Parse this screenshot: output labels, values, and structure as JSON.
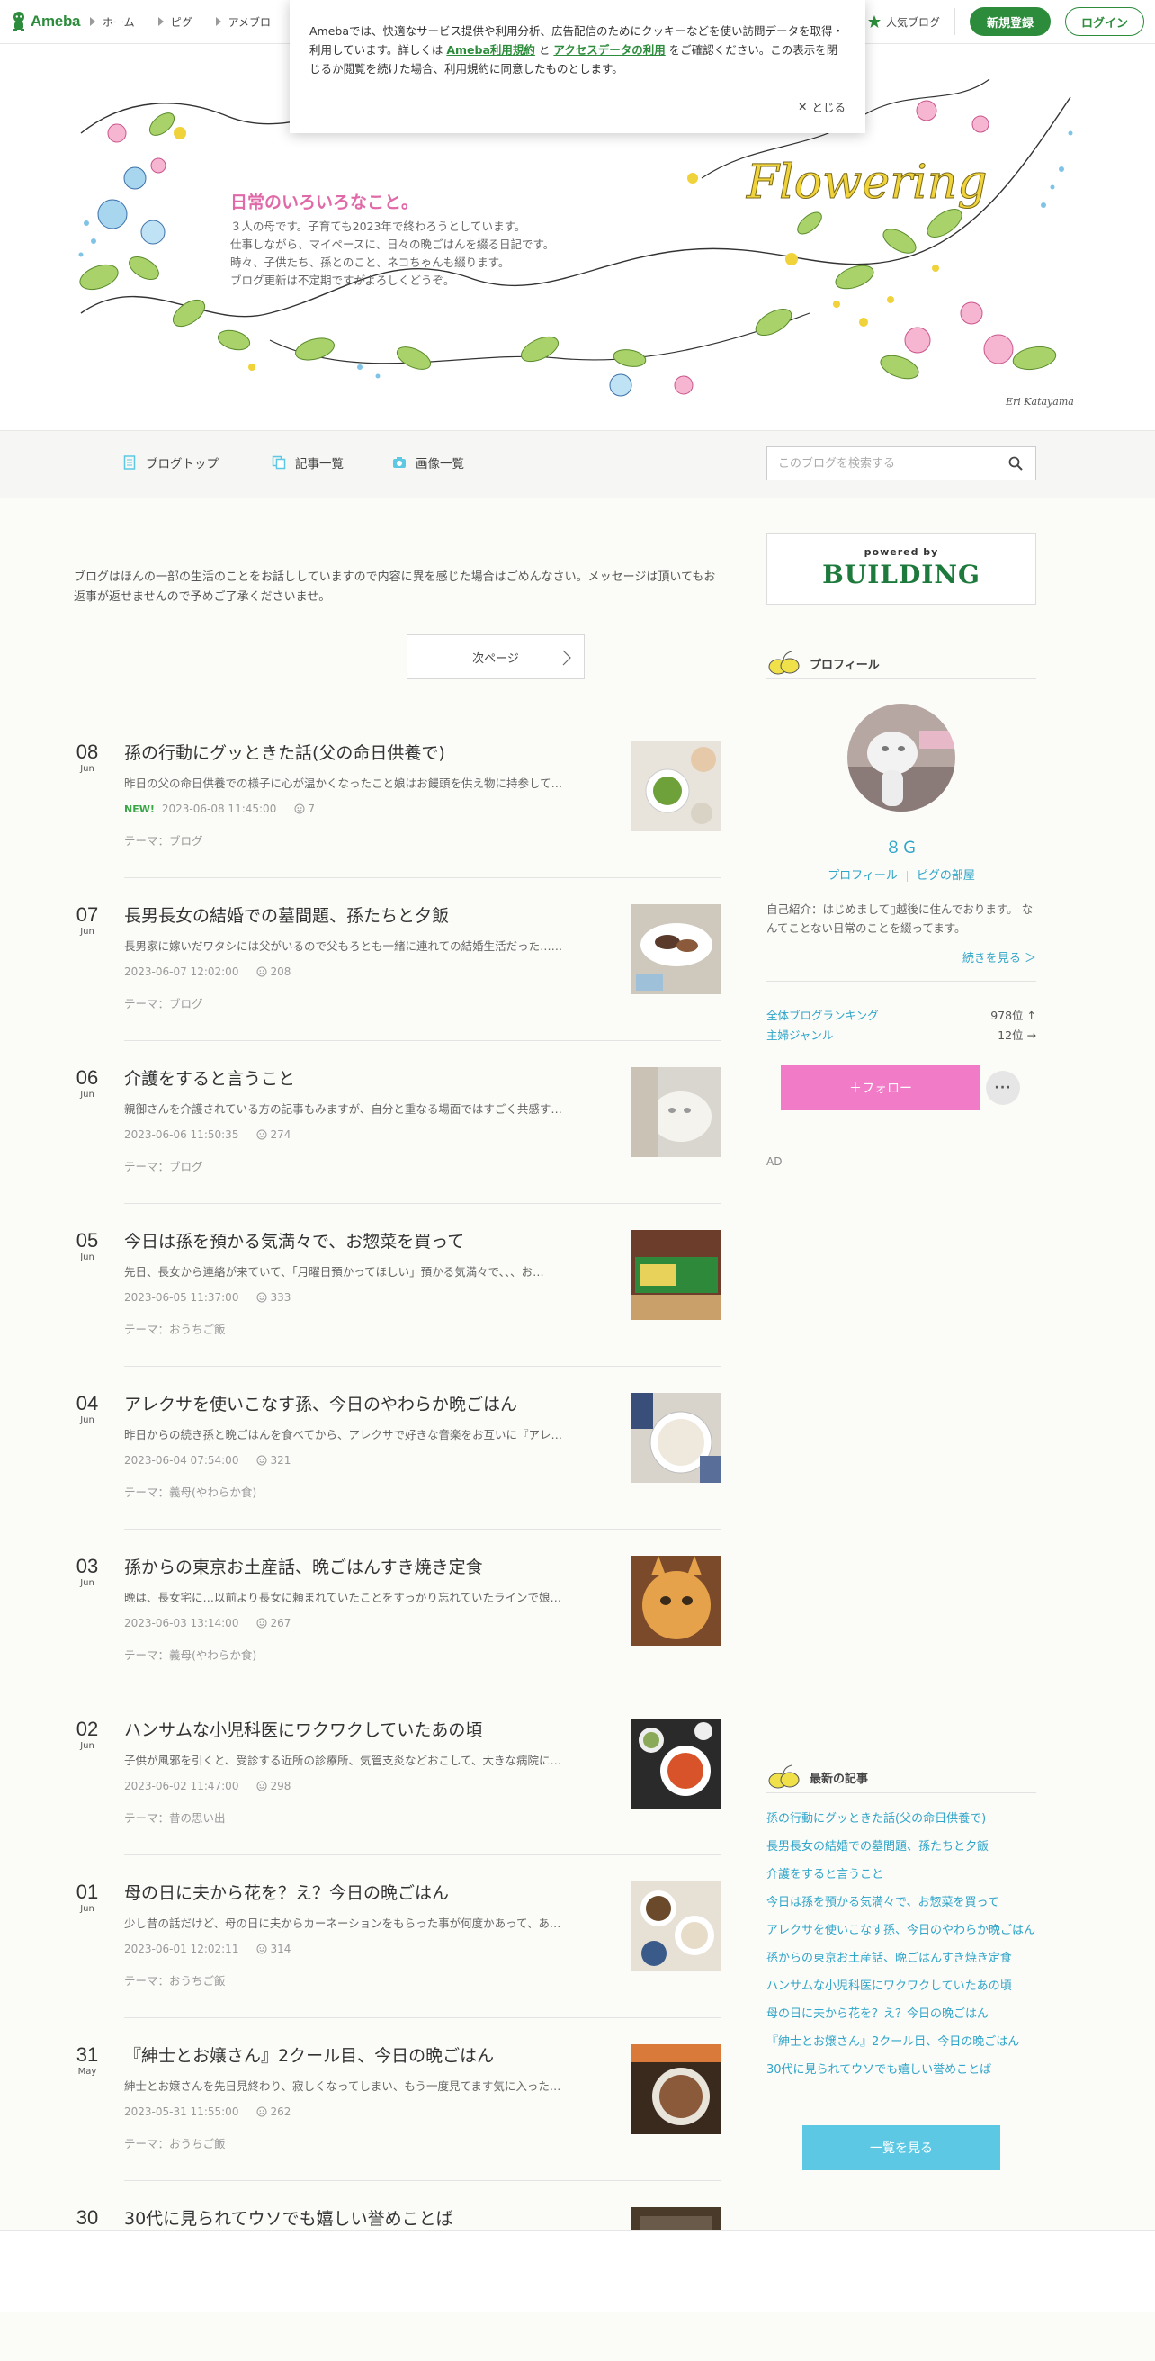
{
  "global_header": {
    "logo_text": "Ameba",
    "nav": [
      "ホーム",
      "ピグ",
      "アメブロ"
    ],
    "popular_blog": "人気ブログ",
    "register": "新規登録",
    "login": "ログイン"
  },
  "cookie_notice": {
    "text_before": "Amebaでは、快適なサービス提供や利用分析、広告配信のためにクッキーなどを使い訪問データを取得・利用しています。詳しくは ",
    "link_terms": "Ameba利用規約",
    "text_and": " と ",
    "link_access": "アクセスデータの利用",
    "text_after": " をご確認ください。この表示を閉じるか閲覧を続けた場合、利用規約に同意したものとします。",
    "close": "とじる"
  },
  "banner": {
    "title": "日常のいろいろなこと。",
    "description": "３人の母です。子育ても2023年で終わろうとしています。\n仕事しながら、マイペースに、日々の晩ごはんを綴る日記です。\n時々、子供たち、孫とのこと、ネコちゃんも綴ります。\nブログ更新は不定期ですがよろしくどうぞ。",
    "artwork_text": "Flowering",
    "signature": "Eri Katayama"
  },
  "blog_nav": {
    "items": [
      "ブログトップ",
      "記事一覧",
      "画像一覧"
    ],
    "search_placeholder": "このブログを検索する"
  },
  "notice": "ブログはほんの一部の生活のことをお話ししていますので内容に異を感じた場合はごめんなさい。メッセージは頂いてもお返事が返せませんので予めご了承くださいませ。",
  "next_page": "次ページ",
  "entries": [
    {
      "day": "08",
      "mon": "Jun",
      "title": "孫の行動にグッときた話(父の命日供養で)",
      "excerpt": "昨日の父の命日供養での様子に心が温かくなったこと娘はお饅頭を供え物に持参して…",
      "new": "NEW!",
      "datetime": "2023-06-08 11:45:00",
      "comments": "7",
      "theme": "テーマ：ブログ"
    },
    {
      "day": "07",
      "mon": "Jun",
      "title": "長男長女の結婚での墓間題、孫たちと夕飯",
      "excerpt": "長男家に嫁いだワタシには父がいるので父もろとも一緒に連れての結婚生活だった……",
      "new": "",
      "datetime": "2023-06-07 12:02:00",
      "comments": "208",
      "theme": "テーマ：ブログ"
    },
    {
      "day": "06",
      "mon": "Jun",
      "title": "介護をすると言うこと",
      "excerpt": "親御さんを介護されている方の記事もみますが、自分と重なる場面ではすごく共感す…",
      "new": "",
      "datetime": "2023-06-06 11:50:35",
      "comments": "274",
      "theme": "テーマ：ブログ"
    },
    {
      "day": "05",
      "mon": "Jun",
      "title": "今日は孫を預かる気満々で、お惣菜を買って",
      "excerpt": "先日、長女から連絡が来ていて、「月曜日預かってほしい」預かる気満々で、、、お…",
      "new": "",
      "datetime": "2023-06-05 11:37:00",
      "comments": "333",
      "theme": "テーマ：おうちご飯"
    },
    {
      "day": "04",
      "mon": "Jun",
      "title": "アレクサを使いこなす孫、今日のやわらか晩ごはん",
      "excerpt": "昨日からの続き孫と晩ごはんを食べてから、アレクサで好きな音楽をお互いに『アレ…",
      "new": "",
      "datetime": "2023-06-04 07:54:00",
      "comments": "321",
      "theme": "テーマ：義母(やわらか食)"
    },
    {
      "day": "03",
      "mon": "Jun",
      "title": "孫からの東京お土産話、晩ごはんすき焼き定食",
      "excerpt": "晩は、長女宅に…以前より長女に頼まれていたことをすっかり忘れていたラインで娘…",
      "new": "",
      "datetime": "2023-06-03 13:14:00",
      "comments": "267",
      "theme": "テーマ：義母(やわらか食)"
    },
    {
      "day": "02",
      "mon": "Jun",
      "title": "ハンサムな小児科医にワクワクしていたあの頃",
      "excerpt": "子供が風邪を引くと、受診する近所の診療所、気管支炎などおこして、大きな病院に…",
      "new": "",
      "datetime": "2023-06-02 11:47:00",
      "comments": "298",
      "theme": "テーマ：昔の思い出"
    },
    {
      "day": "01",
      "mon": "Jun",
      "title": "母の日に夫から花を？え？今日の晩ごはん",
      "excerpt": "少し昔の話だけど、母の日に夫からカーネーションをもらった事が何度かあって、あ…",
      "new": "",
      "datetime": "2023-06-01 12:02:11",
      "comments": "314",
      "theme": "テーマ：おうちご飯"
    },
    {
      "day": "31",
      "mon": "May",
      "title": "『紳士とお嬢さん』2クール目、今日の晩ごはん",
      "excerpt": "紳士とお嬢さんを先日見終わり、寂しくなってしまい、もう一度見てます気に入った…",
      "new": "",
      "datetime": "2023-05-31 11:55:00",
      "comments": "262",
      "theme": "テーマ：おうちご飯"
    },
    {
      "day": "30",
      "mon": "",
      "title": "30代に見られてウソでも嬉しい誉めことば",
      "excerpt": "",
      "new": "",
      "datetime": "",
      "comments": "",
      "theme": ""
    }
  ],
  "sidebar": {
    "ad_powered": "powered by",
    "ad_brand": "BUILDING",
    "profile_heading": "プロフィール",
    "name": "８Ｇ",
    "link_profile": "プロフィール",
    "link_room": "ピグの部屋",
    "intro": "自己紹介：はじめまして▯越後に住んでおります。 なんてことない日常のことを綴ってます。",
    "more": "続きを見る ＞",
    "ranking_total_label": "全体ブログランキング",
    "ranking_total_value": "978位 ↑",
    "ranking_genre_label": "主婦ジャンル",
    "ranking_genre_value": "12位 →",
    "follow": "＋フォロー",
    "more_dots": "···",
    "ad_label": "AD",
    "recent_heading": "最新の記事",
    "recent": [
      "孫の行動にグッときた話(父の命日供養で)",
      "長男長女の結婚での墓間題、孫たちと夕飯",
      "介護をすると言うこと",
      "今日は孫を預かる気満々で、お惣菜を買って",
      "アレクサを使いこなす孫、今日のやわらか晩ごはん",
      "孫からの東京お土産話、晩ごはんすき焼き定食",
      "ハンサムな小児科医にワクワクしていたあの頃",
      "母の日に夫から花を？え？今日の晩ごはん",
      "『紳士とお嬢さん』2クール目、今日の晩ごはん",
      "30代に見られてウソでも嬉しい誉めことば"
    ],
    "recent_all": "一覧を見る"
  },
  "colors": {
    "ameba_green": "#2d8c3c",
    "link_blue": "#2fa5c8",
    "follow_pink": "#f27bc8",
    "list_button": "#5cc8e4",
    "banner_title_pink": "#e06aa8"
  }
}
